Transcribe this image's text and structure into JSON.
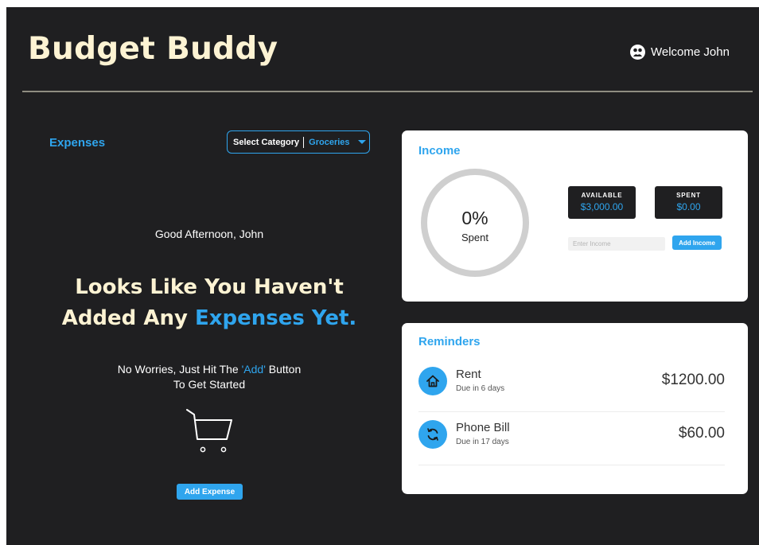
{
  "app": {
    "title": "Budget Buddy"
  },
  "header": {
    "welcome": "Welcome John"
  },
  "expenses": {
    "title": "Expenses",
    "category_label": "Select Category",
    "category_value": "Groceries",
    "greeting": "Good Afternoon, John",
    "headline_line1": "Looks Like You Haven't",
    "headline_line2_prefix": "Added Any ",
    "headline_line2_accent": "Expenses Yet.",
    "hint_prefix": "No Worries, Just Hit The ",
    "hint_accent": "'Add'",
    "hint_suffix": " Button",
    "hint_line2": "To Get Started",
    "add_button": "Add Expense"
  },
  "income": {
    "title": "Income",
    "spent_percent": "0%",
    "spent_label": "Spent",
    "spent_fraction": 0,
    "available_label": "AVAILABLE",
    "available_value": "$3,000.00",
    "spent_stat_label": "SPENT",
    "spent_value": "$0.00",
    "input_placeholder": "Enter Income",
    "add_button": "Add Income"
  },
  "reminders": {
    "title": "Reminders",
    "items": [
      {
        "name": "Rent",
        "due": "Due in 6 days",
        "amount": "$1200.00",
        "icon": "home-icon"
      },
      {
        "name": "Phone Bill",
        "due": "Due in 17 days",
        "amount": "$60.00",
        "icon": "recurring-icon"
      }
    ]
  },
  "colors": {
    "background": "#1f1f21",
    "accent": "#2fa5ee",
    "title": "#fdf3d3",
    "card": "#ffffff",
    "ring": "#cfcfcf"
  }
}
